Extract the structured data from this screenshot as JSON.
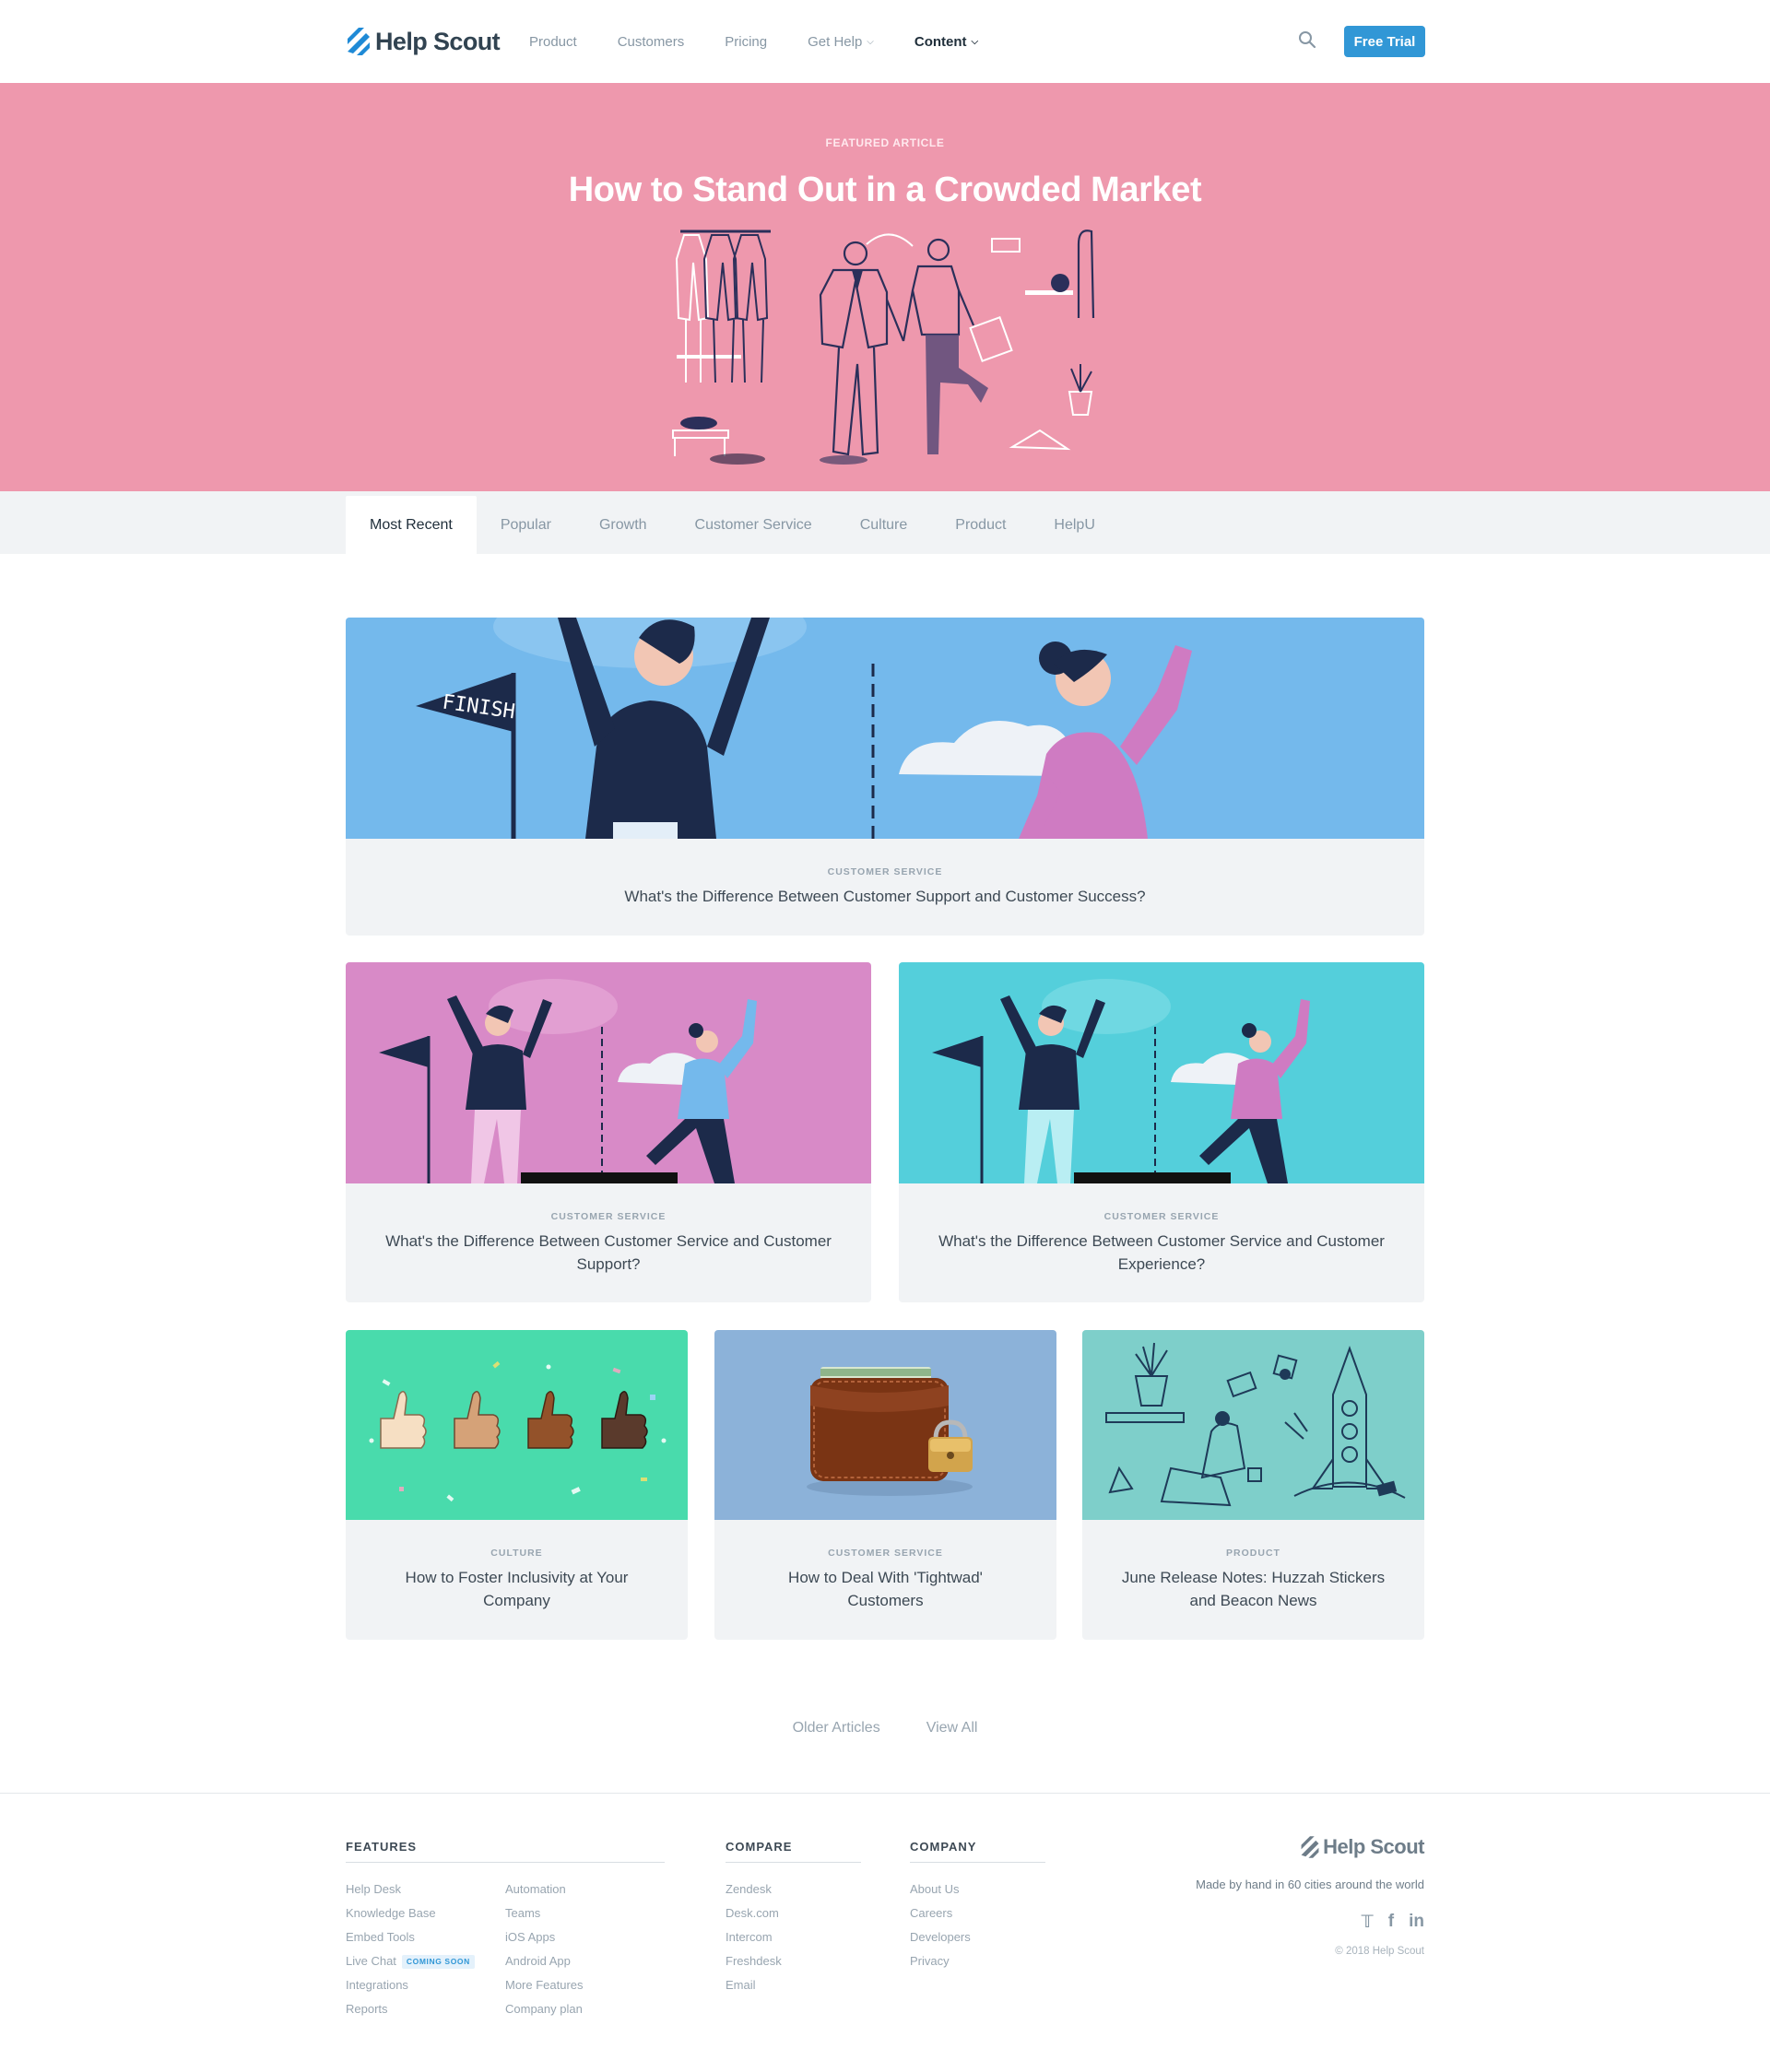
{
  "brand": {
    "name": "Help Scout",
    "accent": "#3197d6",
    "hero_color": "#ee98ad"
  },
  "nav": {
    "items": [
      {
        "label": "Product",
        "dropdown": false,
        "active": false
      },
      {
        "label": "Customers",
        "dropdown": false,
        "active": false
      },
      {
        "label": "Pricing",
        "dropdown": false,
        "active": false
      },
      {
        "label": "Get Help",
        "dropdown": true,
        "active": false
      },
      {
        "label": "Content",
        "dropdown": true,
        "active": true
      }
    ],
    "search_icon": "search-icon",
    "cta_label": "Free Trial"
  },
  "hero": {
    "kicker": "FEATURED ARTICLE",
    "title": "How to Stand Out in a Crowded Market"
  },
  "tabs": [
    {
      "label": "Most Recent",
      "active": true
    },
    {
      "label": "Popular",
      "active": false
    },
    {
      "label": "Growth",
      "active": false
    },
    {
      "label": "Customer Service",
      "active": false
    },
    {
      "label": "Culture",
      "active": false
    },
    {
      "label": "Product",
      "active": false
    },
    {
      "label": "HelpU",
      "active": false
    }
  ],
  "articles": [
    {
      "category": "CUSTOMER SERVICE",
      "title": "What's the Difference Between Customer Support and Customer Success?",
      "image_bg": "#74b9ec"
    },
    {
      "category": "CUSTOMER SERVICE",
      "title": "What's the Difference Between Customer Service and Customer Support?",
      "image_bg": "#d88ac7"
    },
    {
      "category": "CUSTOMER SERVICE",
      "title": "What's the Difference Between Customer Service and Customer Experience?",
      "image_bg": "#54cfdb"
    },
    {
      "category": "CULTURE",
      "title": "How to Foster Inclusivity at Your Company",
      "image_bg": "#49dbac"
    },
    {
      "category": "CUSTOMER SERVICE",
      "title": "How to Deal With 'Tightwad' Customers",
      "image_bg": "#8cb2d9"
    },
    {
      "category": "PRODUCT",
      "title": "June Release Notes: Huzzah Stickers and Beacon News",
      "image_bg": "#7ecfca"
    }
  ],
  "pagination": {
    "older": "Older Articles",
    "view_all": "View All"
  },
  "footer": {
    "features": {
      "heading": "FEATURES",
      "left": [
        "Help Desk",
        "Knowledge Base",
        "Embed Tools",
        "Live Chat",
        "Integrations",
        "Reports"
      ],
      "live_chat_badge": "COMING SOON",
      "right": [
        "Automation",
        "Teams",
        "iOS Apps",
        "Android App",
        "More Features",
        "Company plan"
      ]
    },
    "compare": {
      "heading": "COMPARE",
      "links": [
        "Zendesk",
        "Desk.com",
        "Intercom",
        "Freshdesk",
        "Email"
      ]
    },
    "company": {
      "heading": "COMPANY",
      "links": [
        "About Us",
        "Careers",
        "Developers",
        "Privacy"
      ]
    },
    "logo_text": "Help Scout",
    "tagline": "Made by hand in 60 cities around the world",
    "social": [
      "twitter-icon",
      "facebook-icon",
      "linkedin-icon"
    ],
    "copyright": "© 2018 Help Scout"
  }
}
